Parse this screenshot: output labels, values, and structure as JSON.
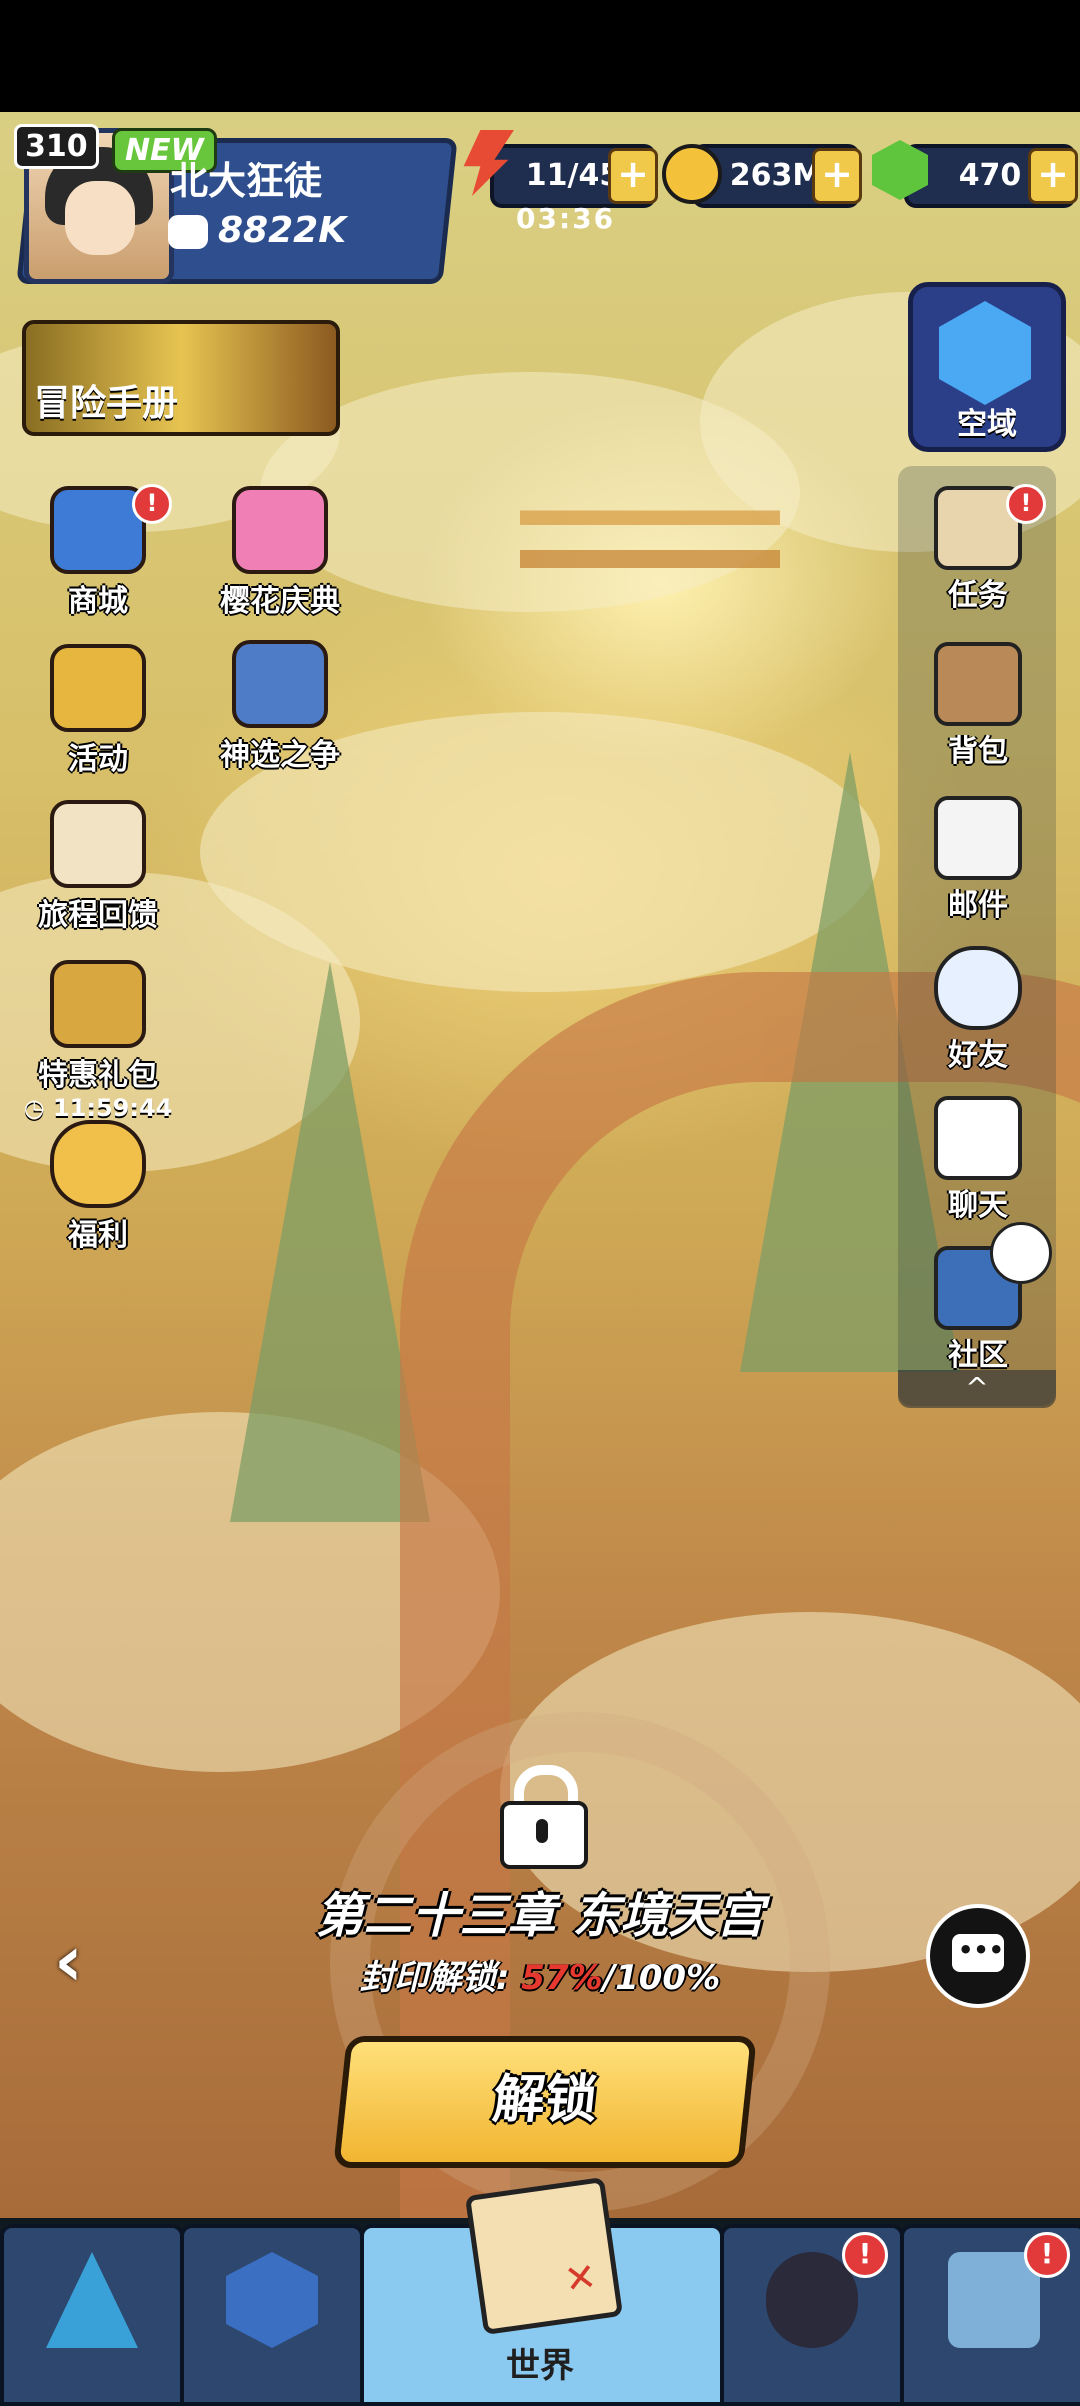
{
  "profile": {
    "level": "310",
    "new_tag": "NEW",
    "name": "北大狂徒",
    "power": "8822K"
  },
  "resources": {
    "energy": "11/45",
    "energy_timer": "03:36",
    "gold": "263M",
    "gems": "470",
    "plus_label": "+"
  },
  "handbook": {
    "label": "冒险手册"
  },
  "left_menu": [
    {
      "label": "商城",
      "badge": "!"
    },
    {
      "label": "樱花庆典"
    },
    {
      "label": "活动"
    },
    {
      "label": "神选之争"
    },
    {
      "label": "旅程回馈"
    },
    {
      "label": "特惠礼包",
      "countdown": "11:59:44"
    },
    {
      "label": "福利"
    }
  ],
  "right_menu": {
    "airspace": "空域",
    "items": [
      {
        "label": "任务",
        "badge": "!"
      },
      {
        "label": "背包"
      },
      {
        "label": "邮件"
      },
      {
        "label": "好友"
      },
      {
        "label": "聊天"
      },
      {
        "label": "社区"
      }
    ],
    "collapse": "^"
  },
  "chapter": {
    "title": "第二十三章 东境天宫",
    "seal_label": "封印解锁:",
    "seal_progress": "57%",
    "seal_total": "/100%",
    "unlock_button": "解锁",
    "back_arrow": "‹"
  },
  "bottom_nav": {
    "active_label": "世界",
    "tabs": [
      "tab-1",
      "tab-2",
      "世界",
      "tab-4",
      "tab-5"
    ],
    "badge": "!"
  },
  "colors": {
    "accent_gold": "#f1b531",
    "badge_red": "#e23a3a",
    "progress_red": "#e5382e",
    "panel_blue": "#2e4e8e"
  }
}
